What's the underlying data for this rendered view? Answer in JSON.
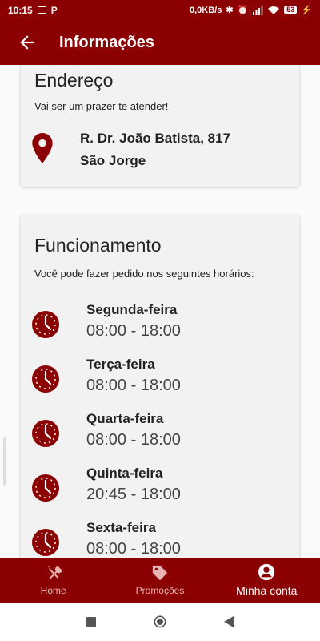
{
  "status_bar": {
    "time": "10:15",
    "network_speed": "0,0KB/s",
    "battery": "53",
    "icons": [
      "notification-box-icon",
      "p-icon",
      "bluetooth-icon",
      "alarm-icon",
      "signal-icon",
      "wifi-icon",
      "battery-icon"
    ]
  },
  "app_bar": {
    "title": "Informações",
    "back_icon": "arrow-back-icon"
  },
  "address_card": {
    "title": "Endereço",
    "subtitle": "Vai ser um prazer te atender!",
    "street": "R. Dr. João Batista, 817",
    "district": "São Jorge",
    "icon": "map-pin-icon"
  },
  "hours_card": {
    "title": "Funcionamento",
    "subtitle": "Você pode fazer pedido nos seguintes horários:",
    "items": [
      {
        "day": "Segunda-feira",
        "time": "08:00 - 18:00"
      },
      {
        "day": "Terça-feira",
        "time": "08:00 - 18:00"
      },
      {
        "day": "Quarta-feira",
        "time": "08:00 - 18:00"
      },
      {
        "day": "Quinta-feira",
        "time": "20:45 - 18:00"
      },
      {
        "day": "Sexta-feira",
        "time": "08:00 - 18:00"
      }
    ]
  },
  "bottom_nav": {
    "items": [
      {
        "label": "Home",
        "icon": "fork-knife-icon"
      },
      {
        "label": "Promoções",
        "icon": "tags-icon"
      },
      {
        "label": "Minha conta",
        "icon": "account-circle-icon",
        "active": true
      }
    ]
  },
  "colors": {
    "primary": "#8b0000",
    "card_bg": "#f2f2f2"
  }
}
